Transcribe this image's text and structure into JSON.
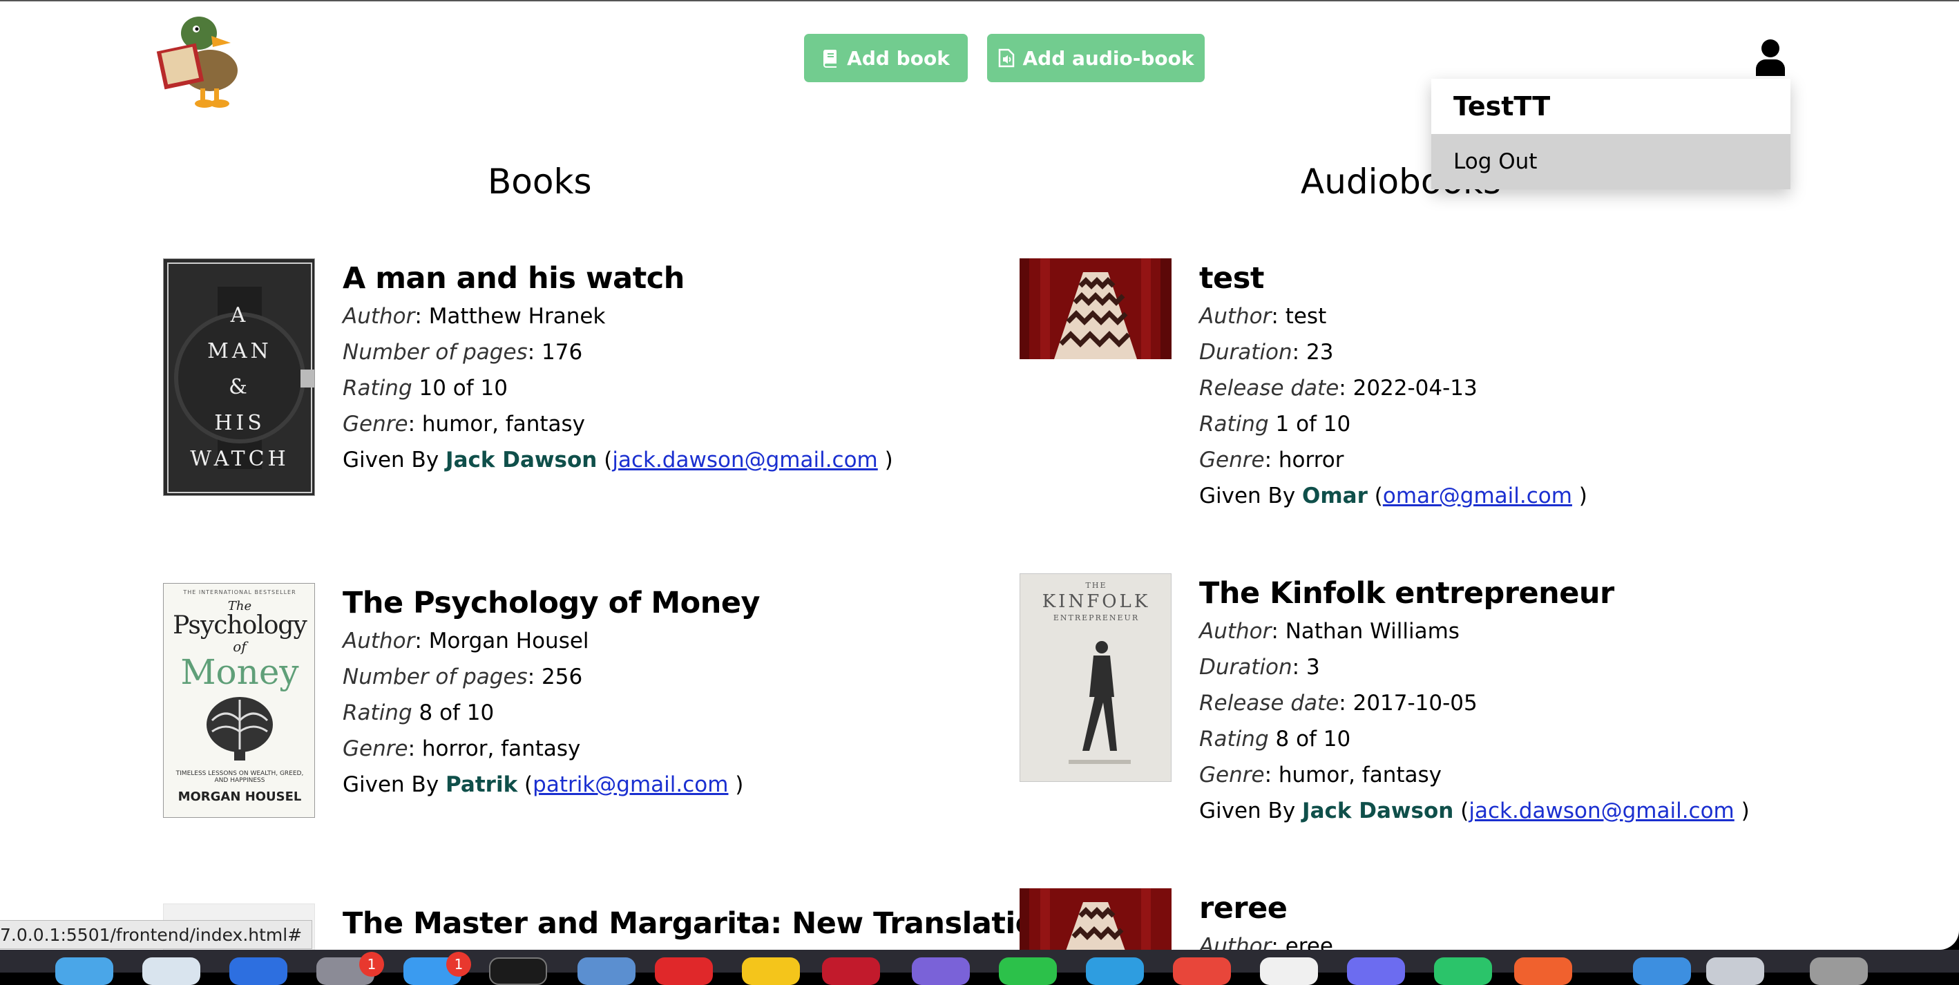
{
  "header": {
    "add_book_label": "Add book",
    "add_audiobook_label": "Add audio-book"
  },
  "user_menu": {
    "username": "TestTT",
    "logout_label": "Log Out"
  },
  "columns": {
    "books_heading": "Books",
    "audiobooks_heading": "Audiobooks"
  },
  "books": [
    {
      "title": "A man and his watch",
      "author_label": "Author",
      "author": "Matthew Hranek",
      "pages_label": "Number of pages",
      "pages": "176",
      "rating_label": "Rating",
      "rating": "10 of 10",
      "genre_label": "Genre",
      "genre": "humor, fantasy",
      "given_by_label": "Given By",
      "giver": "Jack Dawson",
      "email": "jack.dawson@gmail.com",
      "cover": {
        "lines": [
          "A",
          "MAN",
          "&",
          "HIS",
          "WATCH"
        ]
      }
    },
    {
      "title": "The Psychology of Money",
      "author_label": "Author",
      "author": "Morgan Housel",
      "pages_label": "Number of pages",
      "pages": "256",
      "rating_label": "Rating",
      "rating": "8 of 10",
      "genre_label": "Genre",
      "genre": "horror, fantasy",
      "given_by_label": "Given By",
      "giver": "Patrik",
      "email": "patrik@gmail.com",
      "cover": {
        "top": "THE INTERNATIONAL BESTSELLER",
        "t1": "The",
        "t2": "Psychology",
        "t3": "of",
        "t4": "Money",
        "sub": "TIMELESS LESSONS ON WEALTH, GREED, AND HAPPINESS",
        "author": "MORGAN HOUSEL"
      }
    },
    {
      "title": "The Master and Margarita: New Translation"
    }
  ],
  "audiobooks": [
    {
      "title": "test",
      "author_label": "Author",
      "author": "test",
      "duration_label": "Duration",
      "duration": "23",
      "release_label": "Release date",
      "release": "2022-04-13",
      "rating_label": "Rating",
      "rating": "1 of 10",
      "genre_label": "Genre",
      "genre": "horror",
      "given_by_label": "Given By",
      "giver": "Omar",
      "email": "omar@gmail.com"
    },
    {
      "title": "The Kinfolk entrepreneur",
      "author_label": "Author",
      "author": "Nathan Williams",
      "duration_label": "Duration",
      "duration": "3",
      "release_label": "Release date",
      "release": "2017-10-05",
      "rating_label": "Rating",
      "rating": "8 of 10",
      "genre_label": "Genre",
      "genre": "humor, fantasy",
      "given_by_label": "Given By",
      "giver": "Jack Dawson",
      "email": "jack.dawson@gmail.com",
      "cover": {
        "t1": "THE",
        "t2": "KINFOLK",
        "t3": "ENTREPRENEUR"
      }
    },
    {
      "title": "reree",
      "author_label": "Author",
      "author": "eree"
    }
  ],
  "status_bar": {
    "url": "7.0.0.1:5501/frontend/index.html#"
  },
  "dock": {
    "badge_1": "1",
    "badge_2": "1"
  },
  "colors": {
    "button": "#72cc8f",
    "giver": "#0f4f4a",
    "link": "#1a2fd0"
  }
}
